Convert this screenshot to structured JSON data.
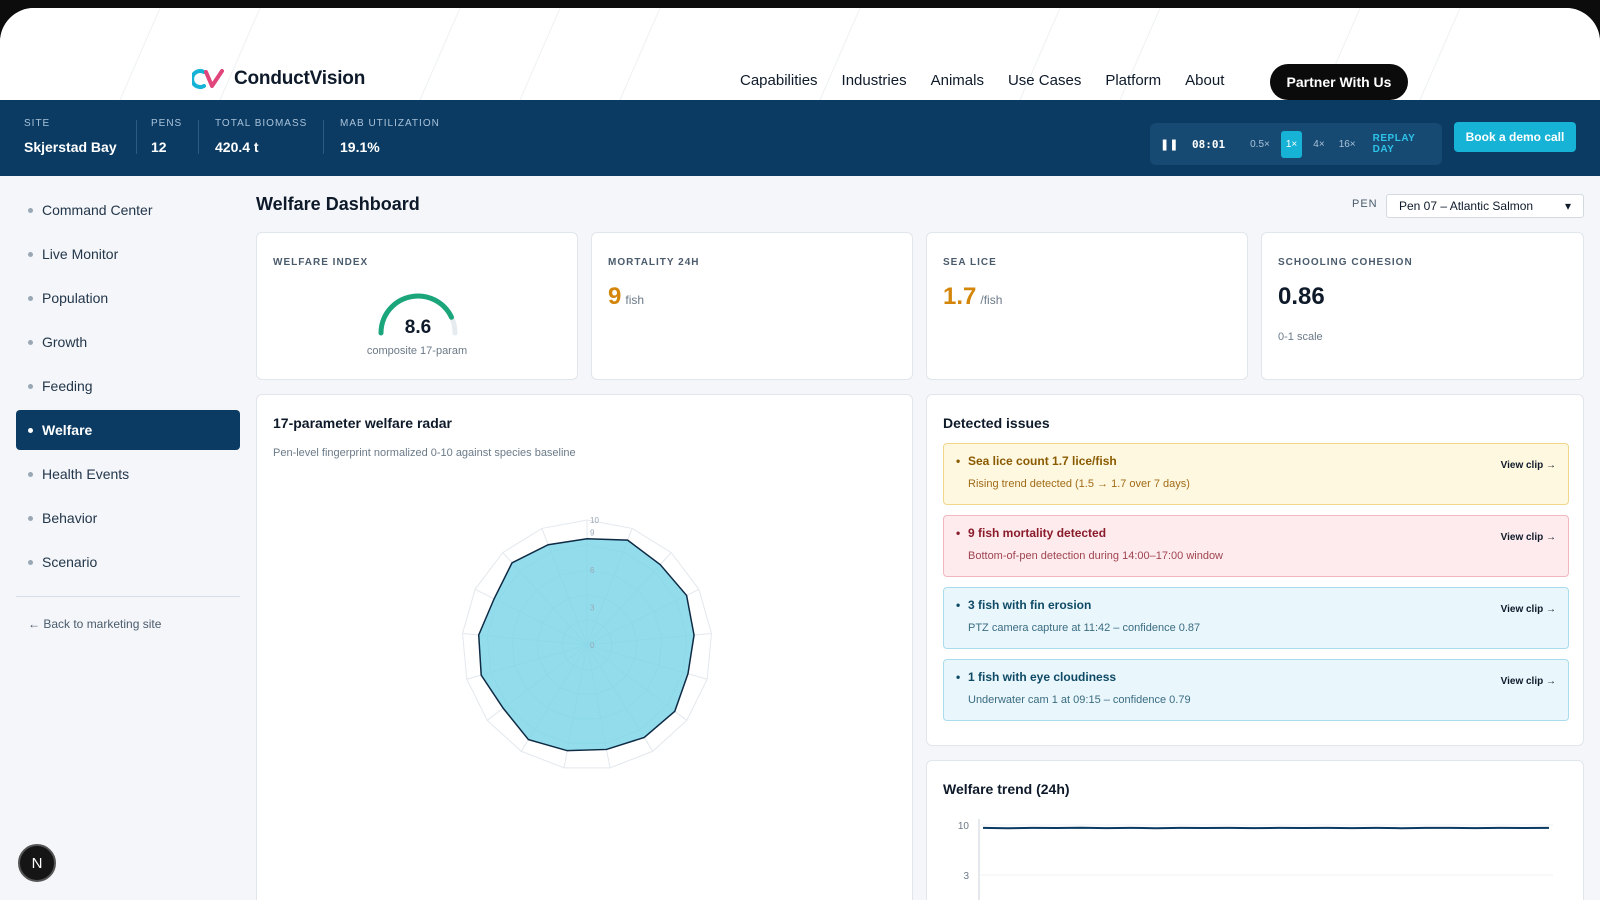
{
  "brand": {
    "name": "ConductVision"
  },
  "nav": {
    "links": [
      "Capabilities",
      "Industries",
      "Animals",
      "Use Cases",
      "Platform",
      "About"
    ],
    "cta": "Partner With Us"
  },
  "status": {
    "site": {
      "label": "SITE",
      "value": "Skjerstad Bay"
    },
    "pens": {
      "label": "PENS",
      "value": "12"
    },
    "biomass": {
      "label": "TOTAL BIOMASS",
      "value": "420.4 t"
    },
    "mab": {
      "label": "MAB UTILIZATION",
      "value": "19.1%"
    }
  },
  "player": {
    "time": "08:01",
    "speeds": [
      "0.5×",
      "1×",
      "4×",
      "16×"
    ],
    "active_speed": "1×",
    "replay": "REPLAY DAY"
  },
  "demo_button": "Book a demo call",
  "sidebar": {
    "items": [
      "Command Center",
      "Live Monitor",
      "Population",
      "Growth",
      "Feeding",
      "Welfare",
      "Health Events",
      "Behavior",
      "Scenario"
    ],
    "active": "Welfare",
    "back": "← Back to marketing site"
  },
  "n_badge": "N",
  "page": {
    "title": "Welfare Dashboard",
    "pen_label": "PEN",
    "pen_value": "Pen 07 – Atlantic Salmon"
  },
  "kpis": {
    "welfare_index": {
      "label": "WELFARE INDEX",
      "value": "8.6",
      "fraction": 0.86,
      "sub": "composite 17-param"
    },
    "mortality": {
      "label": "MORTALITY 24H",
      "value": "9",
      "unit": "fish"
    },
    "sea_lice": {
      "label": "SEA LICE",
      "value": "1.7",
      "unit": "/fish"
    },
    "schooling": {
      "label": "SCHOOLING COHESION",
      "value": "0.86",
      "sub": "0-1 scale"
    }
  },
  "colors": {
    "navy": "#0b3b63",
    "accent": "#16b3d6",
    "warn": "#d4860b",
    "gauge": "#1aa57a",
    "radar_fill": "#7fd6e8"
  },
  "radar": {
    "title": "17-parameter welfare radar",
    "subtitle": "Pen-level fingerprint normalized 0-10 against species baseline",
    "ticks": [
      "10",
      "9",
      "6",
      "3",
      "0"
    ],
    "values": [
      8.5,
      9.0,
      8.7,
      8.9,
      8.6,
      8.4,
      8.8,
      8.7,
      8.5,
      8.6,
      8.9,
      8.4,
      8.8,
      8.7,
      8.3,
      8.9,
      8.6
    ]
  },
  "issues": {
    "title": "Detected issues",
    "clip_label": "View clip →",
    "items": [
      {
        "title": "Sea lice count 1.7 lice/fish",
        "desc": "Rising trend detected (1.5 → 1.7 over 7 days)",
        "level": "warn"
      },
      {
        "title": "9 fish mortality detected",
        "desc": "Bottom-of-pen detection during 14:00–17:00 window",
        "level": "crit"
      },
      {
        "title": "3 fish with fin erosion",
        "desc": "PTZ camera capture at 11:42 – confidence 0.87",
        "level": "info"
      },
      {
        "title": "1 fish with eye cloudiness",
        "desc": "Underwater cam 1 at 09:15 – confidence 0.79",
        "level": "info"
      }
    ]
  },
  "trend": {
    "title": "Welfare trend (24h)",
    "y_ticks": [
      "10",
      "3"
    ],
    "chart_data": {
      "type": "line",
      "ylim": [
        3,
        10
      ],
      "values": [
        9.6,
        9.55,
        9.6,
        9.58,
        9.62,
        9.57,
        9.6,
        9.55,
        9.6,
        9.58,
        9.6,
        9.56,
        9.6,
        9.58,
        9.6,
        9.57,
        9.6,
        9.55,
        9.59,
        9.6,
        9.56,
        9.6,
        9.58,
        9.6
      ]
    }
  }
}
